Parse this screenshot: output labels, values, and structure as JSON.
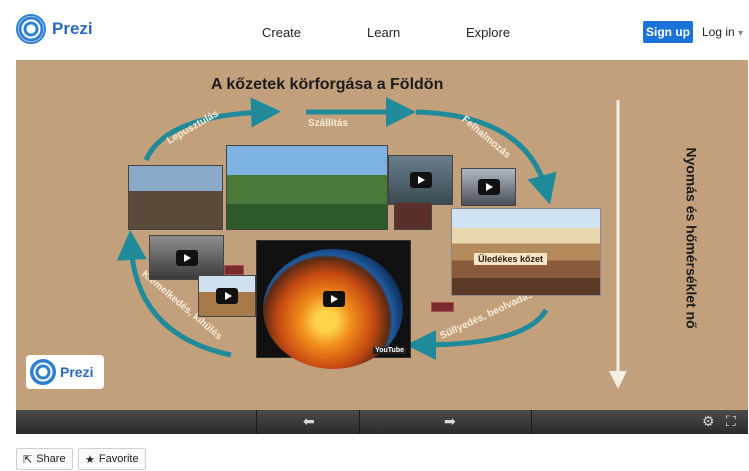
{
  "header": {
    "logo_text": "Prezi",
    "nav": [
      "Create",
      "Learn",
      "Explore"
    ],
    "signup_label": "Sign up",
    "login_label": "Log in",
    "accent_color": "#1a73d9"
  },
  "presentation": {
    "title": "A kőzetek körforgása a Földön",
    "cycle_labels": {
      "top_left": "Lepusztulás",
      "top_middle": "Szállítás",
      "top_right": "Felhalmozás",
      "bottom_right": "Süllyedés, beolvadás",
      "left": "Kiemelkedés, kihűlés"
    },
    "side_label": "Nyomás és hőmérséklet nő",
    "layer_label": "Üledékes kőzet",
    "video_badge": "YouTube",
    "viewer_logo_text": "Prezi",
    "icons": [
      "play-icon",
      "prev-arrow-icon",
      "next-arrow-icon",
      "settings-icon",
      "fullscreen-icon"
    ]
  },
  "controls": {
    "prev_glyph": "⬅",
    "next_glyph": "➡",
    "settings_glyph": "⚙",
    "fullscreen_glyph": "⛶"
  },
  "actions": {
    "share_label": "Share",
    "favorite_label": "Favorite"
  }
}
